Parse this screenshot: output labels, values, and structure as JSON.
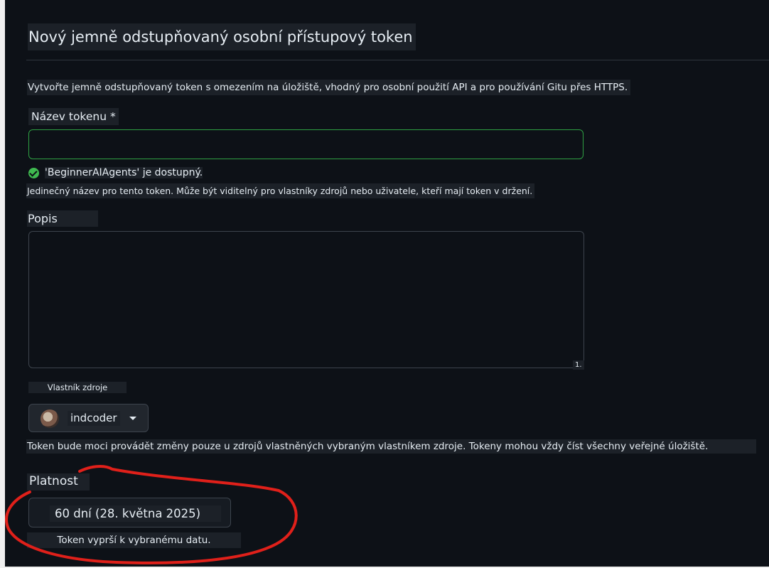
{
  "page": {
    "title": "Nový jemně odstupňovaný osobní přístupový token",
    "description": "Vytvořte jemně odstupňovaný token s omezením na úložiště, vhodný pro osobní použití API a pro používání Gitu přes HTTPS."
  },
  "token_name": {
    "label": "Název tokenu *",
    "value": "",
    "availability": "'BeginnerAIAgents' je dostupný.",
    "hint": "Jedinečný název pro tento token. Může být viditelný pro vlastníky zdrojů nebo uživatele, kteří mají token v držení."
  },
  "description_field": {
    "label": "Popis",
    "value": "",
    "counter": "1."
  },
  "resource_owner": {
    "label": "Vlastník zdroje",
    "selected": "indcoder",
    "hint": "Token bude moci provádět změny pouze u zdrojů vlastněných vybraným vlastníkem zdroje. Tokeny mohou vždy číst všechny veřejné úložiště."
  },
  "expiration": {
    "label": "Platnost",
    "selected": "60 dní (28. května 2025)",
    "hint": "Token vyprší k vybranému datu."
  },
  "colors": {
    "background": "#0d1117",
    "success": "#3fb950",
    "input_valid_border": "#2ea043",
    "annotation": "#e0201a"
  },
  "icons": {
    "availability": "check-circle-icon",
    "owner_dropdown": "caret-down-icon"
  }
}
